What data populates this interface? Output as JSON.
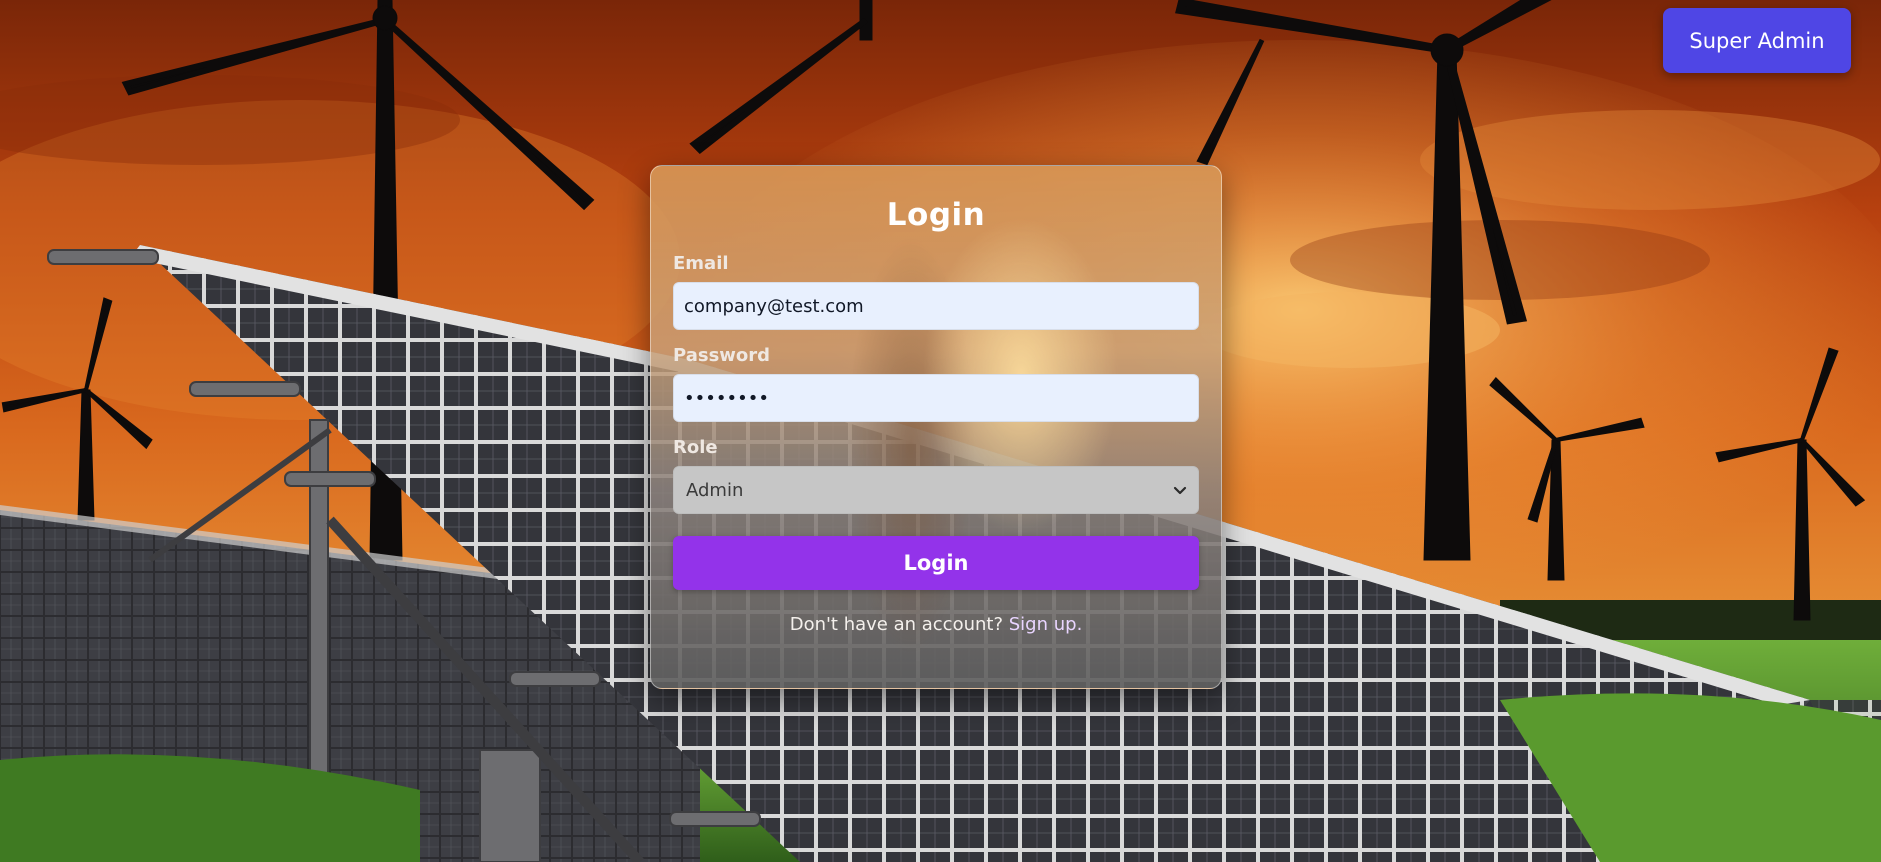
{
  "topbar": {
    "super_admin_label": "Super Admin"
  },
  "login_form": {
    "title": "Login",
    "email_label": "Email",
    "email_value": "company@test.com",
    "password_label": "Password",
    "password_value": "••••••••",
    "role_label": "Role",
    "role_selected": "Admin",
    "submit_label": "Login",
    "signup_prompt": "Don't have an account?",
    "signup_link": "Sign up."
  },
  "background": {
    "scene": "solar-panels-and-wind-turbines",
    "sky_color": "#c8541a",
    "grass_color": "#4f8a2a"
  },
  "colors": {
    "super_admin_button": "#4f46e5",
    "login_button": "#9333ea",
    "input_background": "#e8f0fe"
  },
  "icons": {
    "select_indicator": "chevron-down-icon"
  }
}
